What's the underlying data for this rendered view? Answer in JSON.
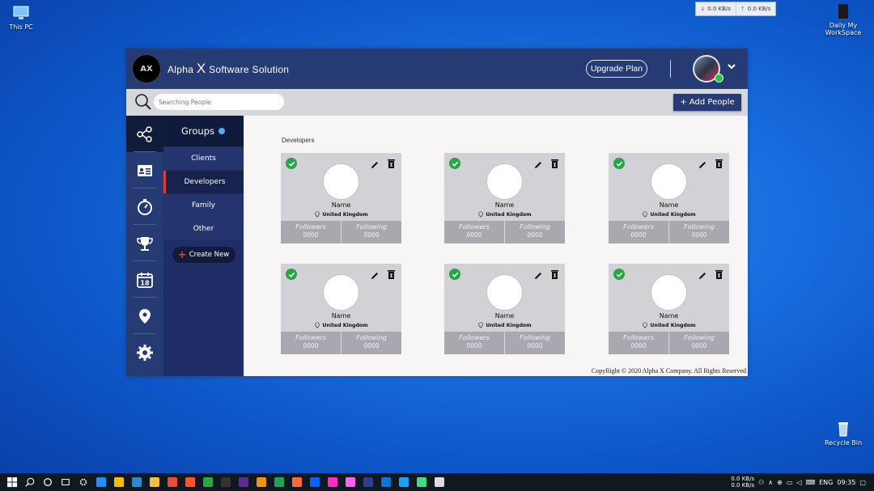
{
  "desktop": {
    "icons": [
      {
        "label": "This PC"
      },
      {
        "label": "Daily My WorkSpace"
      },
      {
        "label": "Recycle Bin"
      }
    ],
    "net_widget": {
      "down": "0.0 KB/s",
      "up": "0.0 KB/s"
    }
  },
  "app": {
    "logo_text": "AX",
    "brand_prefix": "Alpha",
    "brand_x": "X",
    "brand_suffix": "Software Solution",
    "upgrade_label": "Upgrade Plan",
    "search_placeholder": "Searching People",
    "add_people_label": "+ Add People",
    "groups_title": "Groups",
    "groups": [
      {
        "label": "Clients",
        "active": false
      },
      {
        "label": "Developers",
        "active": true
      },
      {
        "label": "Family",
        "active": false
      },
      {
        "label": "Other",
        "active": false
      }
    ],
    "create_new_label": "Create New",
    "rail_icons": [
      "share-icon",
      "contact-card-icon",
      "stopwatch-icon",
      "trophy-icon",
      "calendar-icon",
      "location-icon",
      "settings-icon"
    ],
    "calendar_day": "18",
    "section_title": "Developers",
    "cards": [
      {
        "name": "Name",
        "location": "United Kingdom",
        "followers_label": "Followers",
        "followers": "0000",
        "following_label": "Following",
        "following": "0000"
      },
      {
        "name": "Name",
        "location": "United Kingdom",
        "followers_label": "Followers",
        "followers": "0000",
        "following_label": "Following",
        "following": "0000"
      },
      {
        "name": "Name",
        "location": "United Kingdom",
        "followers_label": "Followers",
        "followers": "0000",
        "following_label": "Following",
        "following": "0000"
      },
      {
        "name": "Name",
        "location": "United Kingdom",
        "followers_label": "Followers",
        "followers": "0000",
        "following_label": "Following",
        "following": "0000"
      },
      {
        "name": "Name",
        "location": "United Kingdom",
        "followers_label": "Followers",
        "followers": "0000",
        "following_label": "Following",
        "following": "0000"
      },
      {
        "name": "Name",
        "location": "United Kingdom",
        "followers_label": "Followers",
        "followers": "0000",
        "following_label": "Following",
        "following": "0000"
      }
    ],
    "copyright": "CopyRight © 2020 Alpha X Company. All Rights Reserved"
  },
  "taskbar": {
    "net_down": "0.0 KB/s",
    "net_up": "0.0 KB/s",
    "language": "ENG",
    "time": "09:35",
    "app_colors": [
      "#1e90ff",
      "#ffb900",
      "#2b88d8",
      "#f0c040",
      "#e74c3c",
      "#fb542b",
      "#28a745",
      "#333333",
      "#5c2d91",
      "#f29111",
      "#23a455",
      "#ff6b35",
      "#0066ff",
      "#ff2bc2",
      "#ff61f6",
      "#2c3e91",
      "#0078d4",
      "#1da1f2",
      "#3ddc84",
      "#dddddd"
    ]
  },
  "colors": {
    "header": "#263a74",
    "rail": "#263a74",
    "accent_red": "#e53a3a",
    "check_green": "#27a547"
  }
}
